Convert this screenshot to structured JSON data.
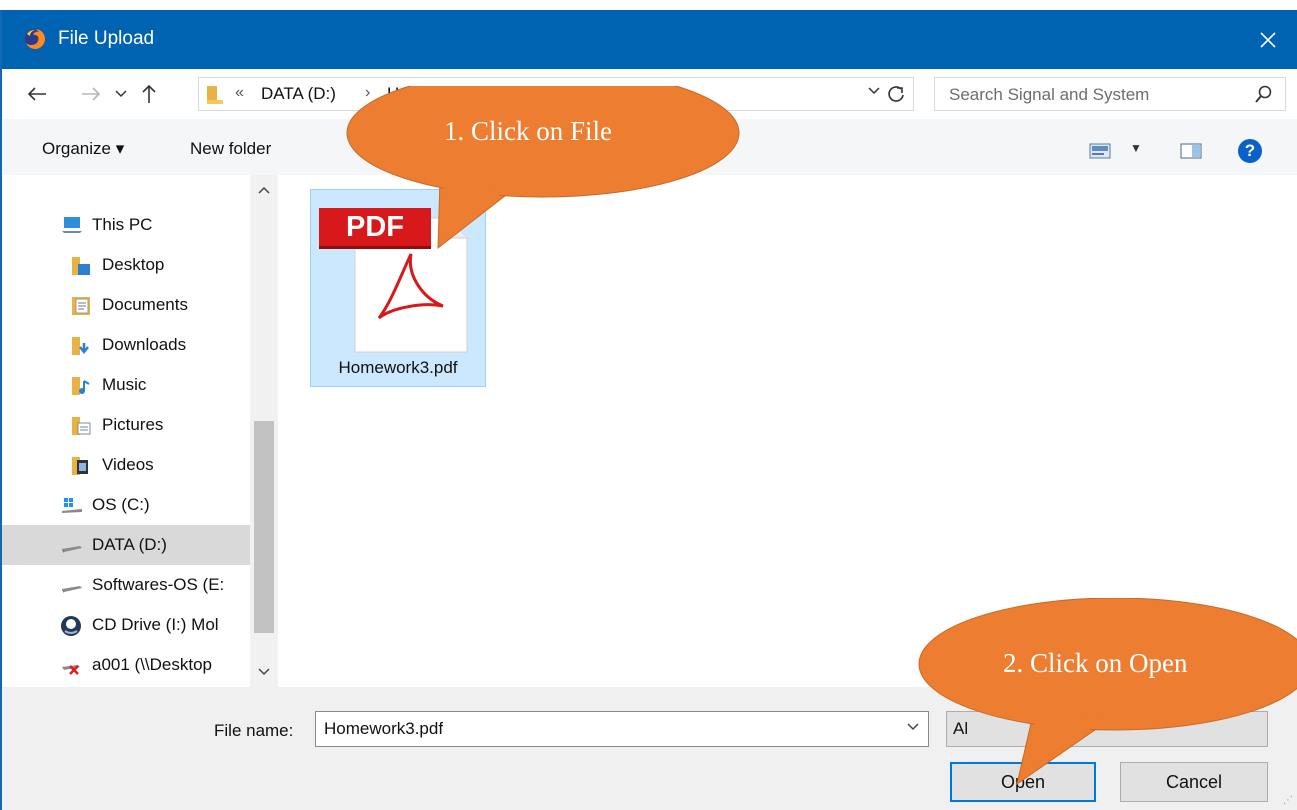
{
  "window": {
    "title": "File Upload"
  },
  "address": {
    "segments": [
      "DATA (D:)",
      "H"
    ],
    "overflow_chevron": "«",
    "separator": "›"
  },
  "search": {
    "placeholder": "Search Signal and System"
  },
  "toolbar": {
    "organize_label": "Organize ▾",
    "new_folder_label": "New folder",
    "help_label": "?"
  },
  "nav_pane": {
    "items": [
      {
        "label": "This PC",
        "icon": "this-pc-icon"
      },
      {
        "label": "Desktop",
        "icon": "desktop-folder-icon"
      },
      {
        "label": "Documents",
        "icon": "documents-folder-icon"
      },
      {
        "label": "Downloads",
        "icon": "downloads-folder-icon"
      },
      {
        "label": "Music",
        "icon": "music-folder-icon"
      },
      {
        "label": "Pictures",
        "icon": "pictures-folder-icon"
      },
      {
        "label": "Videos",
        "icon": "videos-folder-icon"
      },
      {
        "label": "OS (C:)",
        "icon": "windows-drive-icon"
      },
      {
        "label": "DATA (D:)",
        "icon": "drive-icon",
        "selected": true
      },
      {
        "label": "Softwares-OS (E:",
        "icon": "drive-icon"
      },
      {
        "label": "CD Drive (I:) Mol",
        "icon": "cd-drive-icon"
      },
      {
        "label": "a001 (\\\\Desktop",
        "icon": "disconnected-network-drive-icon"
      }
    ]
  },
  "files": [
    {
      "name": "Homework3.pdf",
      "badge": "PDF",
      "selected": true
    }
  ],
  "bottom": {
    "file_name_label": "File name:",
    "file_name_value": "Homework3.pdf",
    "file_type_value": "Al",
    "open_label": "Open",
    "cancel_label": "Cancel"
  },
  "annotations": [
    {
      "text": "1. Click on File"
    },
    {
      "text": "2. Click on Open"
    }
  ],
  "colors": {
    "titlebar": "#0063b1",
    "selection": "#cce8ff",
    "callout": "#ed7d31",
    "pdf_red": "#d7191c",
    "focus_border": "#0078d7"
  }
}
